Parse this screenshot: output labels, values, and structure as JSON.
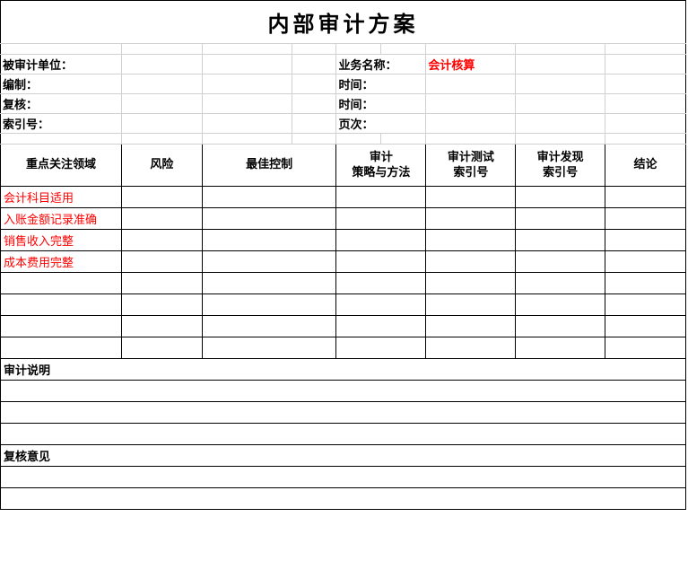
{
  "title": "内部审计方案",
  "info": {
    "audited_unit_label": "被审计单位：",
    "business_name_label": "业务名称：",
    "business_name_value": "会计核算",
    "prepared_by_label": "编制：",
    "time_label_1": "时间：",
    "reviewed_by_label": "复核：",
    "time_label_2": "时间：",
    "index_no_label": "索引号：",
    "page_label": "页次："
  },
  "headers": {
    "focus_area": "重点关注领域",
    "risk": "风险",
    "best_control": "最佳控制",
    "strategy": "审计\n策略与方法",
    "test_index": "审计测试\n索引号",
    "finding_index": "审计发现\n索引号",
    "conclusion": "结论"
  },
  "rows": [
    {
      "focus": "会计科目适用"
    },
    {
      "focus": "入账金额记录准确"
    },
    {
      "focus": "销售收入完整"
    },
    {
      "focus": "成本费用完整"
    },
    {
      "focus": ""
    },
    {
      "focus": ""
    },
    {
      "focus": ""
    },
    {
      "focus": ""
    }
  ],
  "sections": {
    "audit_notes": "审计说明",
    "review_opinion": "复核意见"
  }
}
